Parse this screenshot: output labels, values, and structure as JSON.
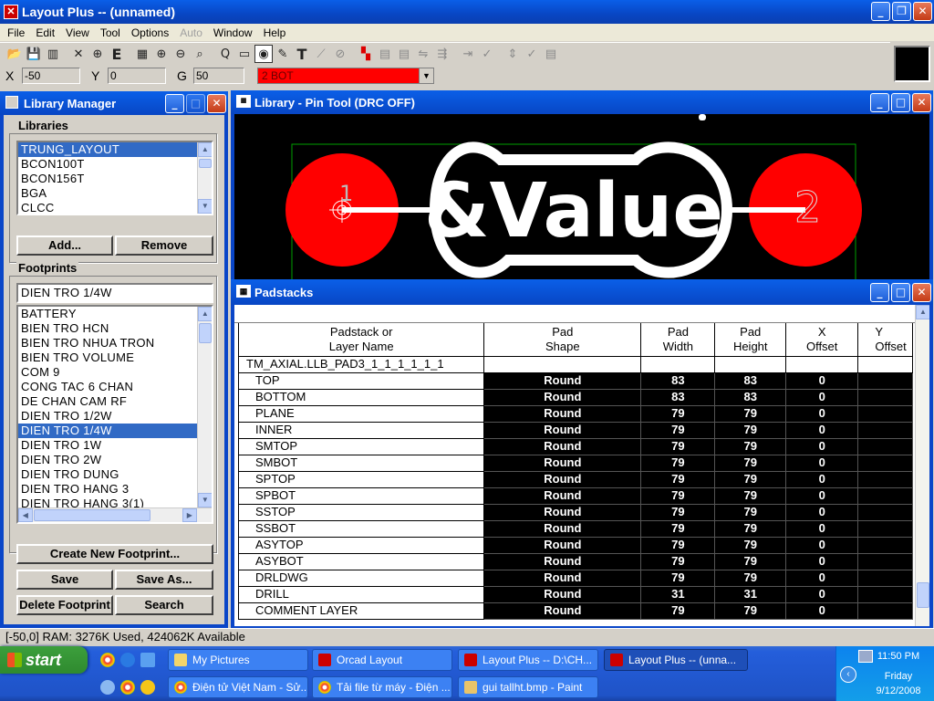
{
  "app": {
    "title": "Layout Plus -- (unnamed)"
  },
  "menu": [
    "File",
    "Edit",
    "View",
    "Tool",
    "Options",
    "Auto",
    "Window",
    "Help"
  ],
  "coords": {
    "x_label": "X",
    "x": "-50",
    "y_label": "Y",
    "y": "0",
    "g_label": "G",
    "g": "50",
    "layer": "2  BOT"
  },
  "library_manager": {
    "title": "Library Manager",
    "libraries_label": "Libraries",
    "libraries": [
      "TRUNG_LAYOUT",
      "BCON100T",
      "BCON156T",
      "BGA",
      "CLCC"
    ],
    "add_label": "Add...",
    "remove_label": "Remove",
    "footprints_label": "Footprints",
    "footprint_value": "DIEN TRO 1/4W",
    "footprints": [
      "BATTERY",
      "BIEN TRO HCN",
      "BIEN TRO NHUA TRON",
      "BIEN TRO VOLUME",
      "COM 9",
      "CONG TAC 6 CHAN",
      "DE CHAN CAM RF",
      "DIEN TRO 1/2W",
      "DIEN TRO 1/4W",
      "DIEN TRO 1W",
      "DIEN TRO 2W",
      "DIEN TRO DUNG",
      "DIEN TRO HANG 3",
      "DIEN TRO HANG 3(1)"
    ],
    "create_label": "Create New Footprint...",
    "save_label": "Save",
    "save_as_label": "Save As...",
    "delete_label": "Delete Footprint",
    "search_label": "Search"
  },
  "pin_tool": {
    "title": "Library - Pin Tool (DRC OFF)",
    "value_text": "&Value",
    "pin1": "1",
    "pin2": "2",
    "colors": {
      "pad": "#ff0000",
      "outline": "#ffffff",
      "boundary": "#00a000"
    }
  },
  "padstacks": {
    "title": "Padstacks",
    "headers": [
      "Padstack or\nLayer Name",
      "Pad\nShape",
      "Pad\nWidth",
      "Pad\nHeight",
      "X\nOffset",
      "Y\nOffset"
    ],
    "group_name": "TM_AXIAL.LLB_PAD3_1_1_1_1_1_1",
    "rows": [
      {
        "name": "TOP",
        "shape": "Round",
        "width": "83",
        "height": "83",
        "xoff": "0"
      },
      {
        "name": "BOTTOM",
        "shape": "Round",
        "width": "83",
        "height": "83",
        "xoff": "0"
      },
      {
        "name": "PLANE",
        "shape": "Round",
        "width": "79",
        "height": "79",
        "xoff": "0"
      },
      {
        "name": "INNER",
        "shape": "Round",
        "width": "79",
        "height": "79",
        "xoff": "0"
      },
      {
        "name": "SMTOP",
        "shape": "Round",
        "width": "79",
        "height": "79",
        "xoff": "0"
      },
      {
        "name": "SMBOT",
        "shape": "Round",
        "width": "79",
        "height": "79",
        "xoff": "0"
      },
      {
        "name": "SPTOP",
        "shape": "Round",
        "width": "79",
        "height": "79",
        "xoff": "0"
      },
      {
        "name": "SPBOT",
        "shape": "Round",
        "width": "79",
        "height": "79",
        "xoff": "0"
      },
      {
        "name": "SSTOP",
        "shape": "Round",
        "width": "79",
        "height": "79",
        "xoff": "0"
      },
      {
        "name": "SSBOT",
        "shape": "Round",
        "width": "79",
        "height": "79",
        "xoff": "0"
      },
      {
        "name": "ASYTOP",
        "shape": "Round",
        "width": "79",
        "height": "79",
        "xoff": "0"
      },
      {
        "name": "ASYBOT",
        "shape": "Round",
        "width": "79",
        "height": "79",
        "xoff": "0"
      },
      {
        "name": "DRLDWG",
        "shape": "Round",
        "width": "79",
        "height": "79",
        "xoff": "0"
      },
      {
        "name": "DRILL",
        "shape": "Round",
        "width": "31",
        "height": "31",
        "xoff": "0"
      },
      {
        "name": "COMMENT LAYER",
        "shape": "Round",
        "width": "79",
        "height": "79",
        "xoff": "0"
      }
    ]
  },
  "status": {
    "text": "[-50,0]  RAM: 3276K Used, 424062K Available"
  },
  "taskbar": {
    "start": "start",
    "row1": [
      "My Pictures",
      "Orcad Layout",
      "Layout Plus -- D:\\CH...",
      "Layout Plus -- (unna..."
    ],
    "row2": [
      "Điện tử Việt Nam - Sử...",
      "Tải file từ máy - Điện ...",
      "gui tallht.bmp - Paint"
    ],
    "clock_time": "11:50 PM",
    "clock_day": "Friday",
    "clock_date": "9/12/2008"
  }
}
